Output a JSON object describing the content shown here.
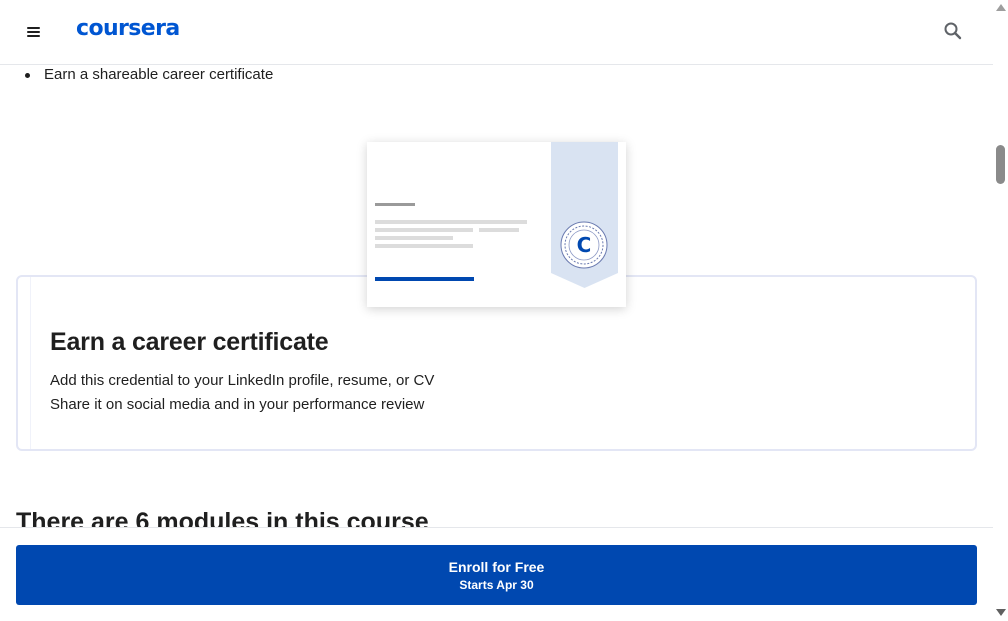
{
  "header": {
    "logo_text": "coursera",
    "menu_icon": "hamburger-menu-icon",
    "search_icon": "search-icon",
    "brand_color": "#0056d2"
  },
  "intro": {
    "bullets": [
      "Earn a shareable career certificate"
    ]
  },
  "certificate": {
    "title": "Earn a career certificate",
    "lines": [
      "Add this credential to your LinkedIn profile, resume, or CV",
      "Share it on social media and in your performance review"
    ],
    "badge_letter": "C",
    "badge_icon": "coursera-badge-icon"
  },
  "modules": {
    "heading": "There are 6 modules in this course"
  },
  "enroll": {
    "label": "Enroll for Free",
    "sub_label": "Starts Apr 30",
    "color": "#0048b0"
  }
}
